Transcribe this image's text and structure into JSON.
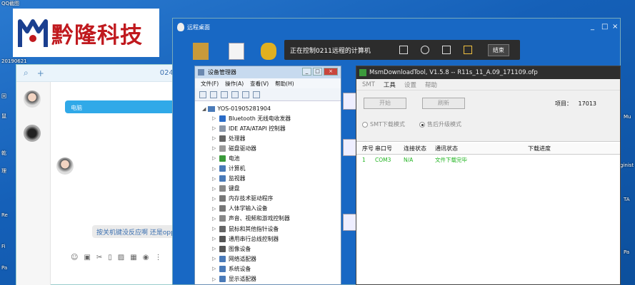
{
  "desktop": {
    "labels": [
      "QQ截图",
      "20190621",
      "回",
      "鼠",
      "乾",
      "理",
      "Re",
      "Fi",
      "Pa"
    ],
    "right_labels": [
      "Mu",
      "ginist",
      "TA",
      "Pa"
    ]
  },
  "logo": {
    "text": "黔隆科技",
    "mark": "M"
  },
  "qq": {
    "blue_bubble": "电脑",
    "gray_bubble": "按关机键没反应啊  还是oppo的手样",
    "label_0245": "0245"
  },
  "remote": {
    "title": "远程桌面",
    "toolbar_status": "正在控制0211远程的计算机",
    "end_button": "结束",
    "window_controls": [
      "_",
      "□",
      "×"
    ]
  },
  "device_manager": {
    "title": "设备管理器",
    "menu": [
      "文件(F)",
      "操作(A)",
      "查看(V)",
      "帮助(H)"
    ],
    "root": "YOS-01905281904",
    "items": [
      "Bluetooth 无线电收发器",
      "IDE ATA/ATAPI 控制器",
      "处理器",
      "磁盘驱动器",
      "电池",
      "计算机",
      "监视器",
      "键盘",
      "内存技术驱动程序",
      "人体学输入设备",
      "声音、视频和游戏控制器",
      "鼠标和其他指针设备",
      "通用串行总线控制器",
      "图像设备",
      "网络适配器",
      "系统设备",
      "显示适配器"
    ]
  },
  "msm": {
    "title": "MsmDownloadTool, V1.5.8 -- R11s_11_A.09_171109.ofp",
    "menu": [
      "SMT",
      "工具",
      "设置",
      "帮助"
    ],
    "start_button": "开始",
    "refresh_button": "刷新",
    "project_label": "项目：",
    "project_value": "17013",
    "radio_smt": "SMT下载模式",
    "radio_upgrade": "售后升级模式",
    "columns": [
      "序号",
      "串口号",
      "连接状态",
      "通讯状态",
      "下载进度"
    ],
    "rows": [
      {
        "num": "1",
        "port": "COM3",
        "conn": "N/A",
        "comm": "文件下载完毕",
        "progress": ""
      }
    ]
  }
}
